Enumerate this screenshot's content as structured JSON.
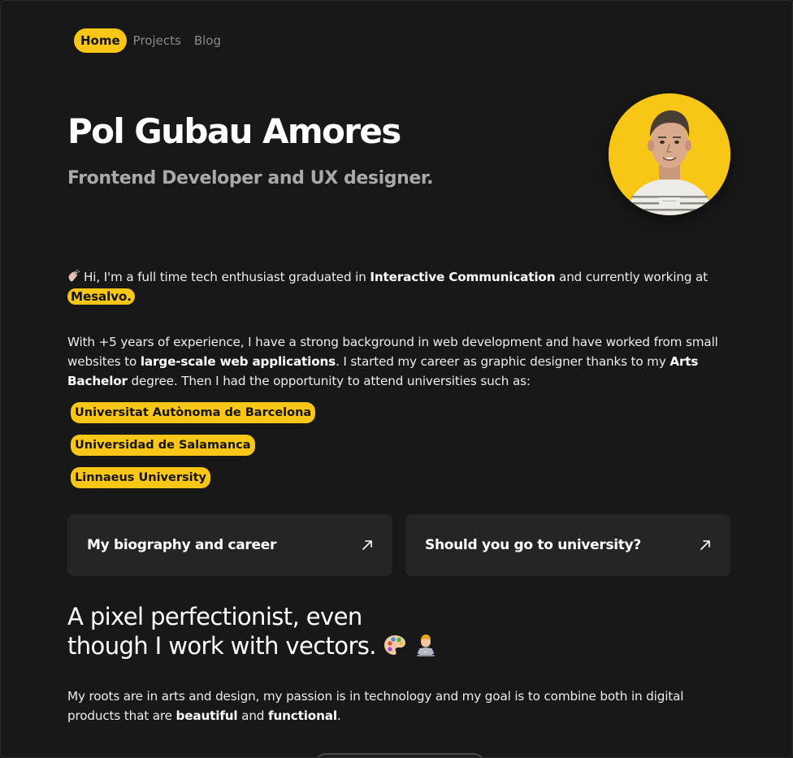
{
  "nav": {
    "items": [
      {
        "label": "Home",
        "active": true
      },
      {
        "label": "Projects",
        "active": false
      },
      {
        "label": "Blog",
        "active": false
      }
    ]
  },
  "hero": {
    "name": "Pol Gubau Amores",
    "role": "Frontend Developer and UX designer."
  },
  "intro": {
    "wave_icon": "waving-hand-icon",
    "part1": "Hi, I'm a full time tech enthusiast graduated in ",
    "bold1": "Interactive Communication",
    "part2": " and currently working at ",
    "company": "Mesalvo."
  },
  "experience": {
    "part1": "With +5 years of experience, I have a strong background in web development and have worked from small websites to ",
    "bold1": "large-scale web applications",
    "part2": ". I started my career as graphic designer thanks to my ",
    "bold2": "Arts Bachelor",
    "part3": " degree. Then I had the opportunity to attend universities such as:"
  },
  "universities": [
    "Universitat Autònoma de Barcelona",
    "Universidad de Salamanca",
    "Linnaeus University"
  ],
  "cards": [
    {
      "title": "My biography and career",
      "icon": "arrow-up-right-icon"
    },
    {
      "title": "Should you go to university?",
      "icon": "arrow-up-right-icon"
    }
  ],
  "section": {
    "title_line1": "A pixel perfectionist, even",
    "title_line2": "though I work with vectors.",
    "emoji1": "artist-palette-icon",
    "emoji2": "technologist-icon"
  },
  "roots": {
    "part1": "My roots are in arts and design, my passion is in technology and my goal is to combine both in digital products that are ",
    "bold1": "beautiful",
    "part2": " and ",
    "bold2": "functional",
    "part3": "."
  },
  "colors": {
    "accent": "#f8c617",
    "background": "#181818",
    "card": "#252525"
  }
}
